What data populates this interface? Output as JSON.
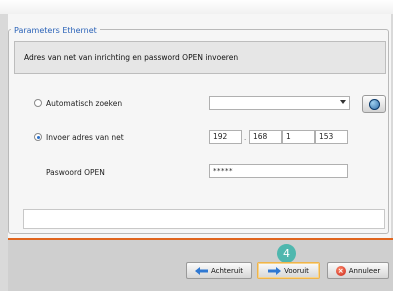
{
  "dialog": {
    "group_title": "Parameters Ethernet",
    "instruction": "Adres van net van inrichting en password OPEN invoeren"
  },
  "options": {
    "auto_label": "Automatisch zoeken",
    "manual_label": "Invoer adres van net",
    "selected": "manual"
  },
  "combo": {
    "value": ""
  },
  "ip": {
    "octet1": "192",
    "octet2": "168",
    "octet3": "1",
    "octet4": "153",
    "separator": "."
  },
  "password": {
    "label": "Paswoord OPEN",
    "value": "*****"
  },
  "buttons": {
    "back": "Achteruit",
    "next": "Vooruit",
    "cancel": "Annuleer"
  },
  "annotation": {
    "step": "4"
  },
  "icons": {
    "search": "globe-network-icon",
    "back": "arrow-left-icon",
    "next": "arrow-right-icon",
    "cancel": "cancel-x-icon"
  },
  "colors": {
    "accent": "#2b63b8",
    "divider": "#e0651e",
    "badge": "#4fb7ae"
  }
}
